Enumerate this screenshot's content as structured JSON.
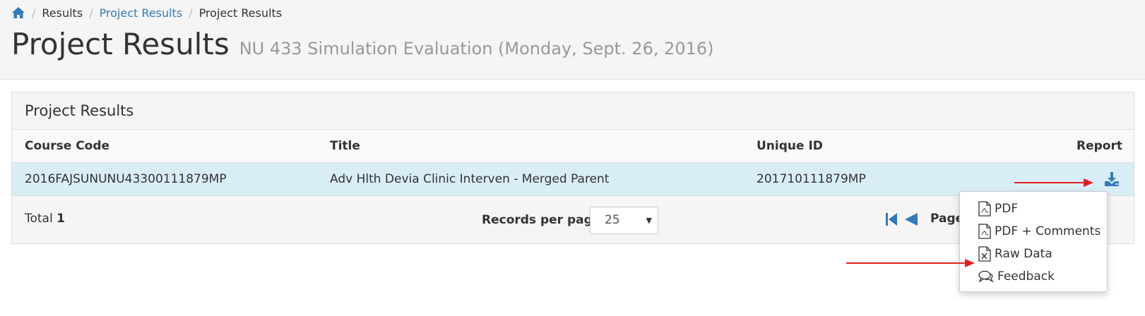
{
  "breadcrumb": {
    "items": [
      {
        "label": "Results"
      },
      {
        "label": "Project Results"
      },
      {
        "label": "Project Results"
      }
    ],
    "home_icon": "home-icon"
  },
  "page": {
    "title": "Project Results",
    "subtitle": "NU 433 Simulation Evaluation (Monday, Sept. 26, 2016)"
  },
  "panel": {
    "heading": "Project Results",
    "columns": [
      "Course Code",
      "Title",
      "Unique ID",
      "Report"
    ],
    "rows": [
      {
        "course_code": "2016FAJSUNUNU43300111879MP",
        "title": "Adv Hlth Devia Clinic Interven - Merged Parent",
        "unique_id": "201710111879MP",
        "report_icon": "download-icon"
      }
    ],
    "footer": {
      "total_label": "Total",
      "total_value": "1",
      "records_per_page_label": "Records per page",
      "records_per_page_value": "25",
      "page_label": "Page"
    }
  },
  "report_menu": {
    "items": [
      {
        "label": "PDF",
        "icon": "pdf-file-icon"
      },
      {
        "label": "PDF + Comments",
        "icon": "pdf-file-icon"
      },
      {
        "label": "Raw Data",
        "icon": "excel-file-icon"
      },
      {
        "label": "Feedback",
        "icon": "comments-icon"
      }
    ]
  },
  "colors": {
    "link": "#337ab7",
    "row_highlight": "#d9edf7",
    "annotation_arrow": "#e02020"
  }
}
